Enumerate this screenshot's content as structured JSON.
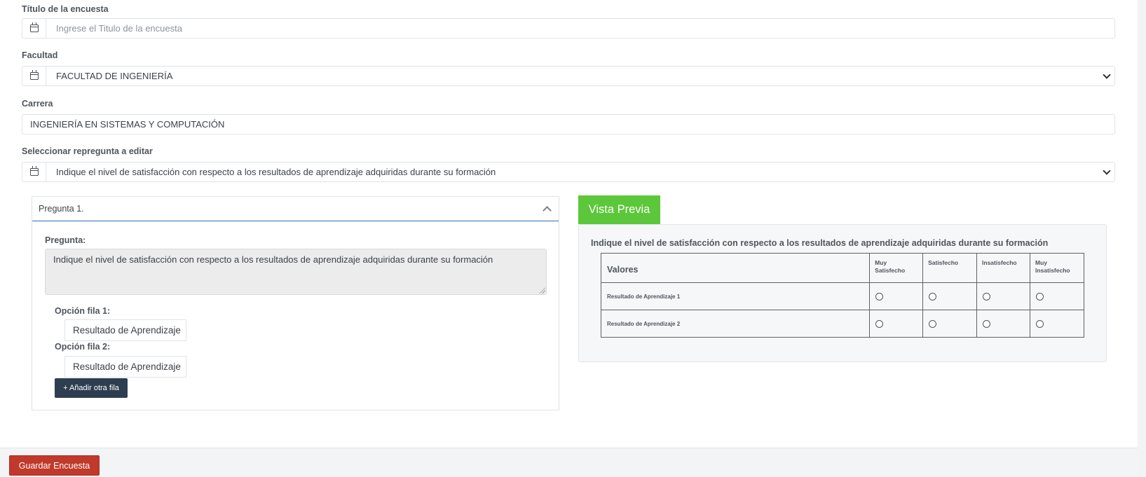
{
  "form": {
    "title_label": "Título de la encuesta",
    "title_placeholder": "Ingrese el Titulo de la encuesta",
    "faculty_label": "Facultad",
    "faculty_value": "FACULTAD DE INGENIERÍA",
    "career_label": "Carrera",
    "career_value": "INGENIERÍA EN SISTEMAS Y COMPUTACIÓN",
    "question_select_label": "Seleccionar repregunta a editar",
    "question_select_value": "Indique el nivel de satisfacción con respecto a los resultados de aprendizaje adquiridas durante su formación"
  },
  "editor": {
    "card_title": "Pregunta 1.",
    "question_label": "Pregunta:",
    "question_text": "Indique el nivel de satisfacción con respecto a los resultados de aprendizaje adquiridas durante su formación",
    "rows": [
      {
        "label": "Opción fila 1:",
        "value": "Resultado de Aprendizaje"
      },
      {
        "label": "Opción fila 2:",
        "value": "Resultado de Aprendizaje"
      }
    ],
    "add_row_button": "+ Añadir otra fila"
  },
  "preview": {
    "button_label": "Vista Previa",
    "question": "Indique el nivel de satisfacción con respecto a los resultados de aprendizaje adquiridas durante su formación",
    "header_first": "Valores",
    "columns": [
      "Muy Satisfecho",
      "Satisfecho",
      "Insatisfecho",
      "Muy Insatisfecho"
    ],
    "rows": [
      "Resultado de Aprendizaje 1",
      "Resultado de Aprendizaje 2"
    ]
  },
  "footer": {
    "save_button": "Guardar Encuesta"
  },
  "icons": {
    "field_addon": "calendar-icon",
    "select_arrow": "chevron-down-icon",
    "collapse": "chevron-up-icon"
  },
  "colors": {
    "preview_button": "#5cc73a",
    "save_button": "#c0392b",
    "add_row_button": "#2d3e50",
    "card_header_border": "#2f6fb5"
  }
}
